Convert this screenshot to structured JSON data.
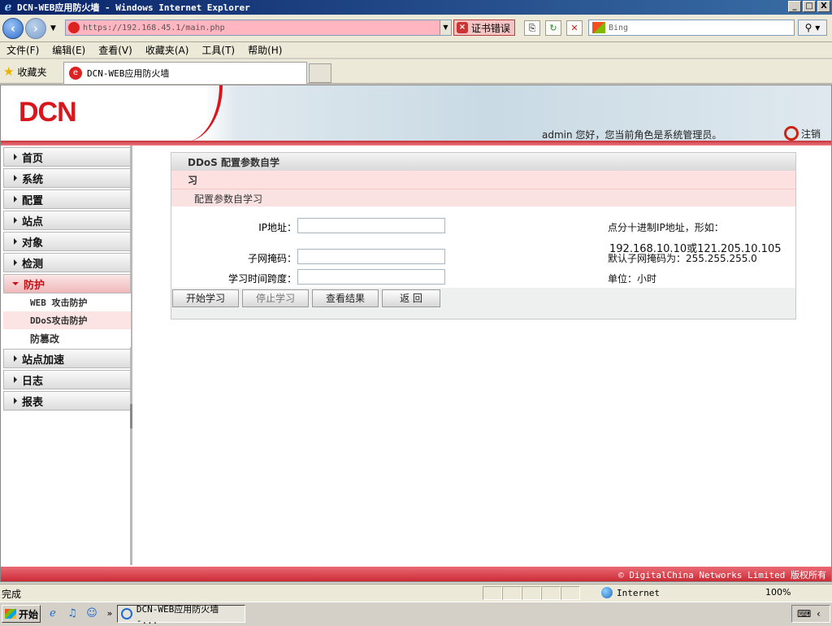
{
  "window": {
    "title": "DCN-WEB应用防火墙 - Windows Internet Explorer",
    "min": "_",
    "max": "□",
    "close": "X"
  },
  "address": {
    "url": "https://192.168.45.1/main.php",
    "cert_error": "证书错误",
    "search_placeholder": "Bing",
    "search_go": "⚲ ▾"
  },
  "menu": [
    "文件(F)",
    "编辑(E)",
    "查看(V)",
    "收藏夹(A)",
    "工具(T)",
    "帮助(H)"
  ],
  "favbar": {
    "favorites": "收藏夹",
    "tab_title": "DCN-WEB应用防火墙"
  },
  "banner": {
    "logo": "DCN",
    "greeting": "admin 您好，您当前角色是系统管理员。",
    "logout": "注销"
  },
  "sidebar": {
    "items": [
      {
        "label": "首页"
      },
      {
        "label": "系统"
      },
      {
        "label": "配置"
      },
      {
        "label": "站点"
      },
      {
        "label": "对象"
      },
      {
        "label": "检测"
      },
      {
        "label": "防护"
      },
      {
        "label": "站点加速"
      },
      {
        "label": "日志"
      },
      {
        "label": "报表"
      }
    ],
    "subitems": [
      {
        "label": "WEB 攻击防护"
      },
      {
        "label": "DDoS攻击防护"
      },
      {
        "label": "防篡改"
      }
    ]
  },
  "panel": {
    "title": "DDoS 配置参数自学",
    "title_wrap": "习",
    "section": "配置参数自学习",
    "fields": [
      {
        "label": "IP地址：",
        "value": "",
        "hint": "点分十进制IP地址，形如："
      },
      {
        "label": "",
        "value": "",
        "hint": "192.168.10.10或121.205.10.105"
      },
      {
        "label": "子网掩码：",
        "value": "",
        "hint": "默认子网掩码为：255.255.255.0"
      },
      {
        "label": "学习时间跨度：",
        "value": "",
        "hint": "单位：小时"
      }
    ],
    "buttons": {
      "start": "开始学习",
      "stop": "停止学习",
      "view": "查看结果",
      "back": "返 回"
    }
  },
  "footer": {
    "copyright": "© DigitalChina Networks Limited 版权所有"
  },
  "statusbar": {
    "status": "完成",
    "zone": "Internet",
    "zoom": "100%"
  },
  "taskbar": {
    "start": "开始",
    "task": "DCN-WEB应用防火墙 -..."
  }
}
